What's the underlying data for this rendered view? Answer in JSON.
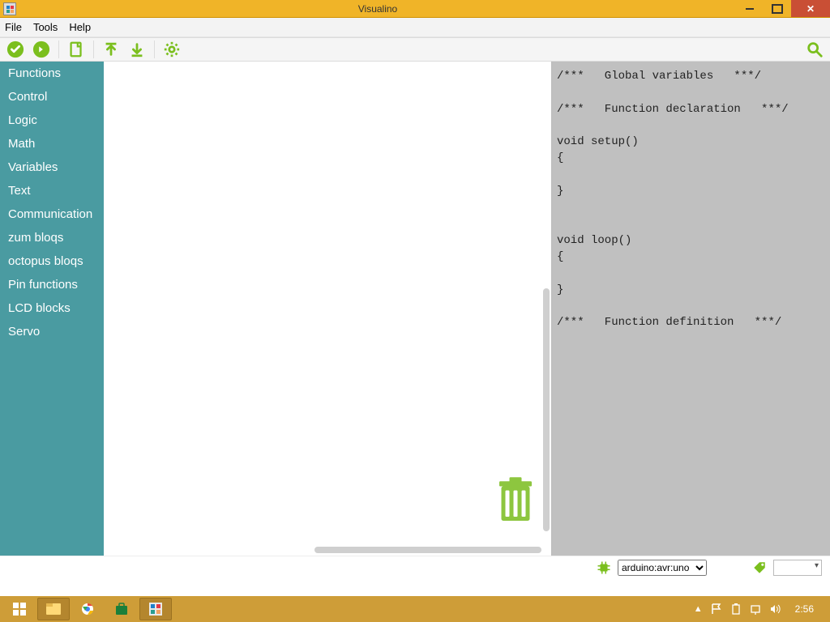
{
  "window": {
    "title": "Visualino"
  },
  "menu": {
    "file": "File",
    "tools": "Tools",
    "help": "Help"
  },
  "sidebar": {
    "items": [
      {
        "label": "Functions"
      },
      {
        "label": "Control"
      },
      {
        "label": "Logic"
      },
      {
        "label": "Math"
      },
      {
        "label": "Variables"
      },
      {
        "label": "Text"
      },
      {
        "label": "Communication"
      },
      {
        "label": "zum bloqs"
      },
      {
        "label": "octopus bloqs"
      },
      {
        "label": "Pin functions"
      },
      {
        "label": "LCD blocks"
      },
      {
        "label": "Servo"
      }
    ]
  },
  "code": "/***   Global variables   ***/\n\n/***   Function declaration   ***/\n\nvoid setup()\n{\n\n}\n\n\nvoid loop()\n{\n\n}\n\n/***   Function definition   ***/",
  "status": {
    "board": "arduino:avr:uno"
  },
  "taskbar": {
    "clock": "2:56"
  },
  "colors": {
    "accent": "#7bbf1e",
    "sidebar": "#4a9ba1",
    "title": "#f0b428"
  }
}
